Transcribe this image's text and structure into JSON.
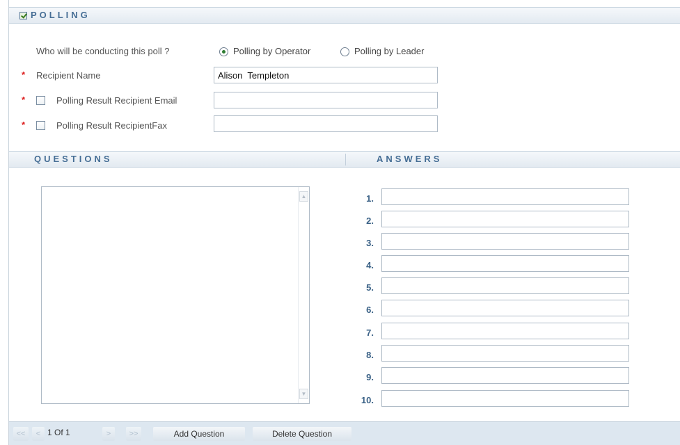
{
  "polling": {
    "title": "POLLING",
    "conducted_question": "Who will be conducting this poll ?",
    "options": [
      {
        "label": "Polling by Operator",
        "selected": true
      },
      {
        "label": "Polling by Leader",
        "selected": false
      }
    ],
    "required_marker": "*",
    "recipient_name": {
      "label": "Recipient Name",
      "value": "Alison  Templeton"
    },
    "result_email": {
      "label": "Polling Result Recipient Email",
      "value": "",
      "checked": false
    },
    "result_fax": {
      "label": "Polling Result RecipientFax",
      "value": "",
      "checked": false
    }
  },
  "questions": {
    "title": "QUESTIONS",
    "text": ""
  },
  "answers": {
    "title": "ANSWERS",
    "items": [
      {
        "num": "1.",
        "value": ""
      },
      {
        "num": "2.",
        "value": ""
      },
      {
        "num": "3.",
        "value": ""
      },
      {
        "num": "4.",
        "value": ""
      },
      {
        "num": "5.",
        "value": ""
      },
      {
        "num": "6.",
        "value": ""
      },
      {
        "num": "7.",
        "value": ""
      },
      {
        "num": "8.",
        "value": ""
      },
      {
        "num": "9.",
        "value": ""
      },
      {
        "num": "10.",
        "value": ""
      }
    ]
  },
  "toolbar": {
    "first": "<<",
    "prev": "<",
    "page": "1 Of 1",
    "next": ">",
    "last": ">>",
    "add_question": "Add Question",
    "delete_question": "Delete Question"
  },
  "colors": {
    "accent": "#466e95",
    "required": "#dd2222",
    "toolbar_bg": "#dde7f0"
  }
}
